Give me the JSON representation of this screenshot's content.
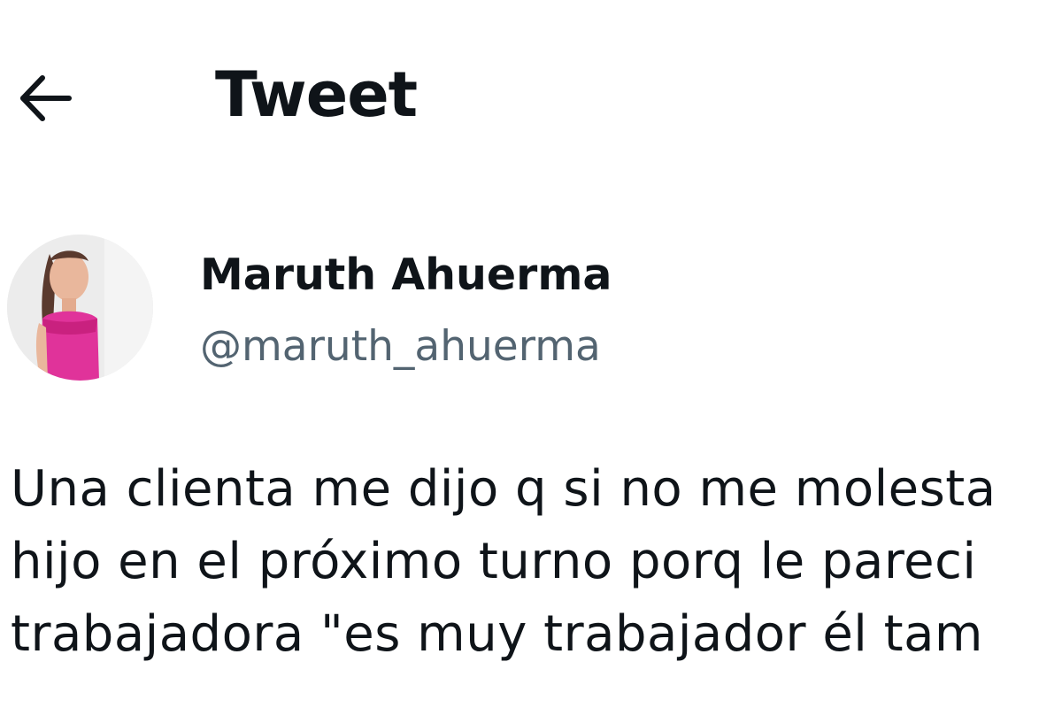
{
  "header": {
    "back_icon": "arrow-left-icon",
    "title": "Tweet"
  },
  "author": {
    "avatar_icon": "profile-photo",
    "display_name": "Maruth Ahuerma",
    "handle": "@maruth_ahuerma"
  },
  "tweet": {
    "lines": [
      "Una clienta me dijo q si no me molesta",
      "hijo en el próximo turno porq le pareci",
      "trabajadora \"es muy trabajador él tam"
    ]
  },
  "colors": {
    "text_primary": "#0f1419",
    "text_secondary": "#536471",
    "background": "#ffffff",
    "avatar_accent": "#e0339a"
  }
}
